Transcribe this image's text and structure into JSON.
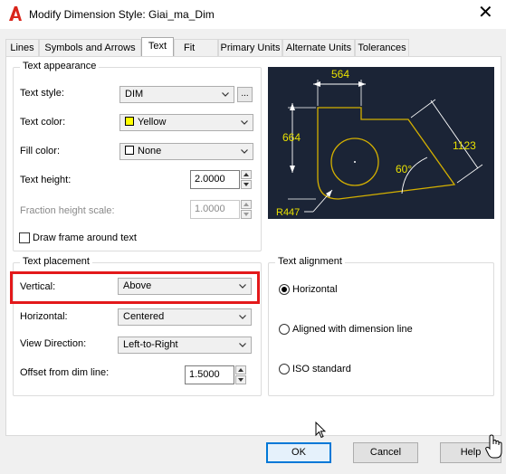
{
  "window": {
    "title": "Modify Dimension Style: Giai_ma_Dim",
    "close_glyph": "✕"
  },
  "tabs": [
    {
      "label": "Lines"
    },
    {
      "label": "Symbols and Arrows"
    },
    {
      "label": "Text"
    },
    {
      "label": "Fit"
    },
    {
      "label": "Primary Units"
    },
    {
      "label": "Alternate Units"
    },
    {
      "label": "Tolerances"
    }
  ],
  "active_tab": "Text",
  "text_appearance": {
    "legend": "Text appearance",
    "text_style_label": "Text style:",
    "text_style_value": "DIM",
    "ellipsis": "...",
    "text_color_label": "Text color:",
    "text_color_value": "Yellow",
    "text_color_swatch": "#ffff00",
    "fill_color_label": "Fill color:",
    "fill_color_value": "None",
    "text_height_label": "Text height:",
    "text_height_value": "2.0000",
    "fraction_height_label": "Fraction height scale:",
    "fraction_height_value": "1.0000",
    "draw_frame_label": "Draw frame around text",
    "draw_frame_checked": false
  },
  "text_placement": {
    "legend": "Text placement",
    "vertical_label": "Vertical:",
    "vertical_value": "Above",
    "horizontal_label": "Horizontal:",
    "horizontal_value": "Centered",
    "view_direction_label": "View Direction:",
    "view_direction_value": "Left-to-Right",
    "offset_label": "Offset from dim line:",
    "offset_value": "1.5000"
  },
  "text_alignment": {
    "legend": "Text alignment",
    "options": [
      {
        "label": "Horizontal",
        "checked": true
      },
      {
        "label": "Aligned with dimension line",
        "checked": false
      },
      {
        "label": "ISO standard",
        "checked": false
      }
    ]
  },
  "preview": {
    "dim_top": "564",
    "dim_left": "664",
    "dim_right": "1123",
    "dim_angle": "60°",
    "dim_radius": "R447",
    "background": "#1b2436",
    "line_color": "#ffffff",
    "geometry_color": "#d4b000",
    "text_color": "#e8e000"
  },
  "buttons": {
    "ok": "OK",
    "cancel": "Cancel",
    "help": "Help"
  },
  "colors": {
    "highlight": "#e3191b",
    "accent": "#0078d7"
  }
}
